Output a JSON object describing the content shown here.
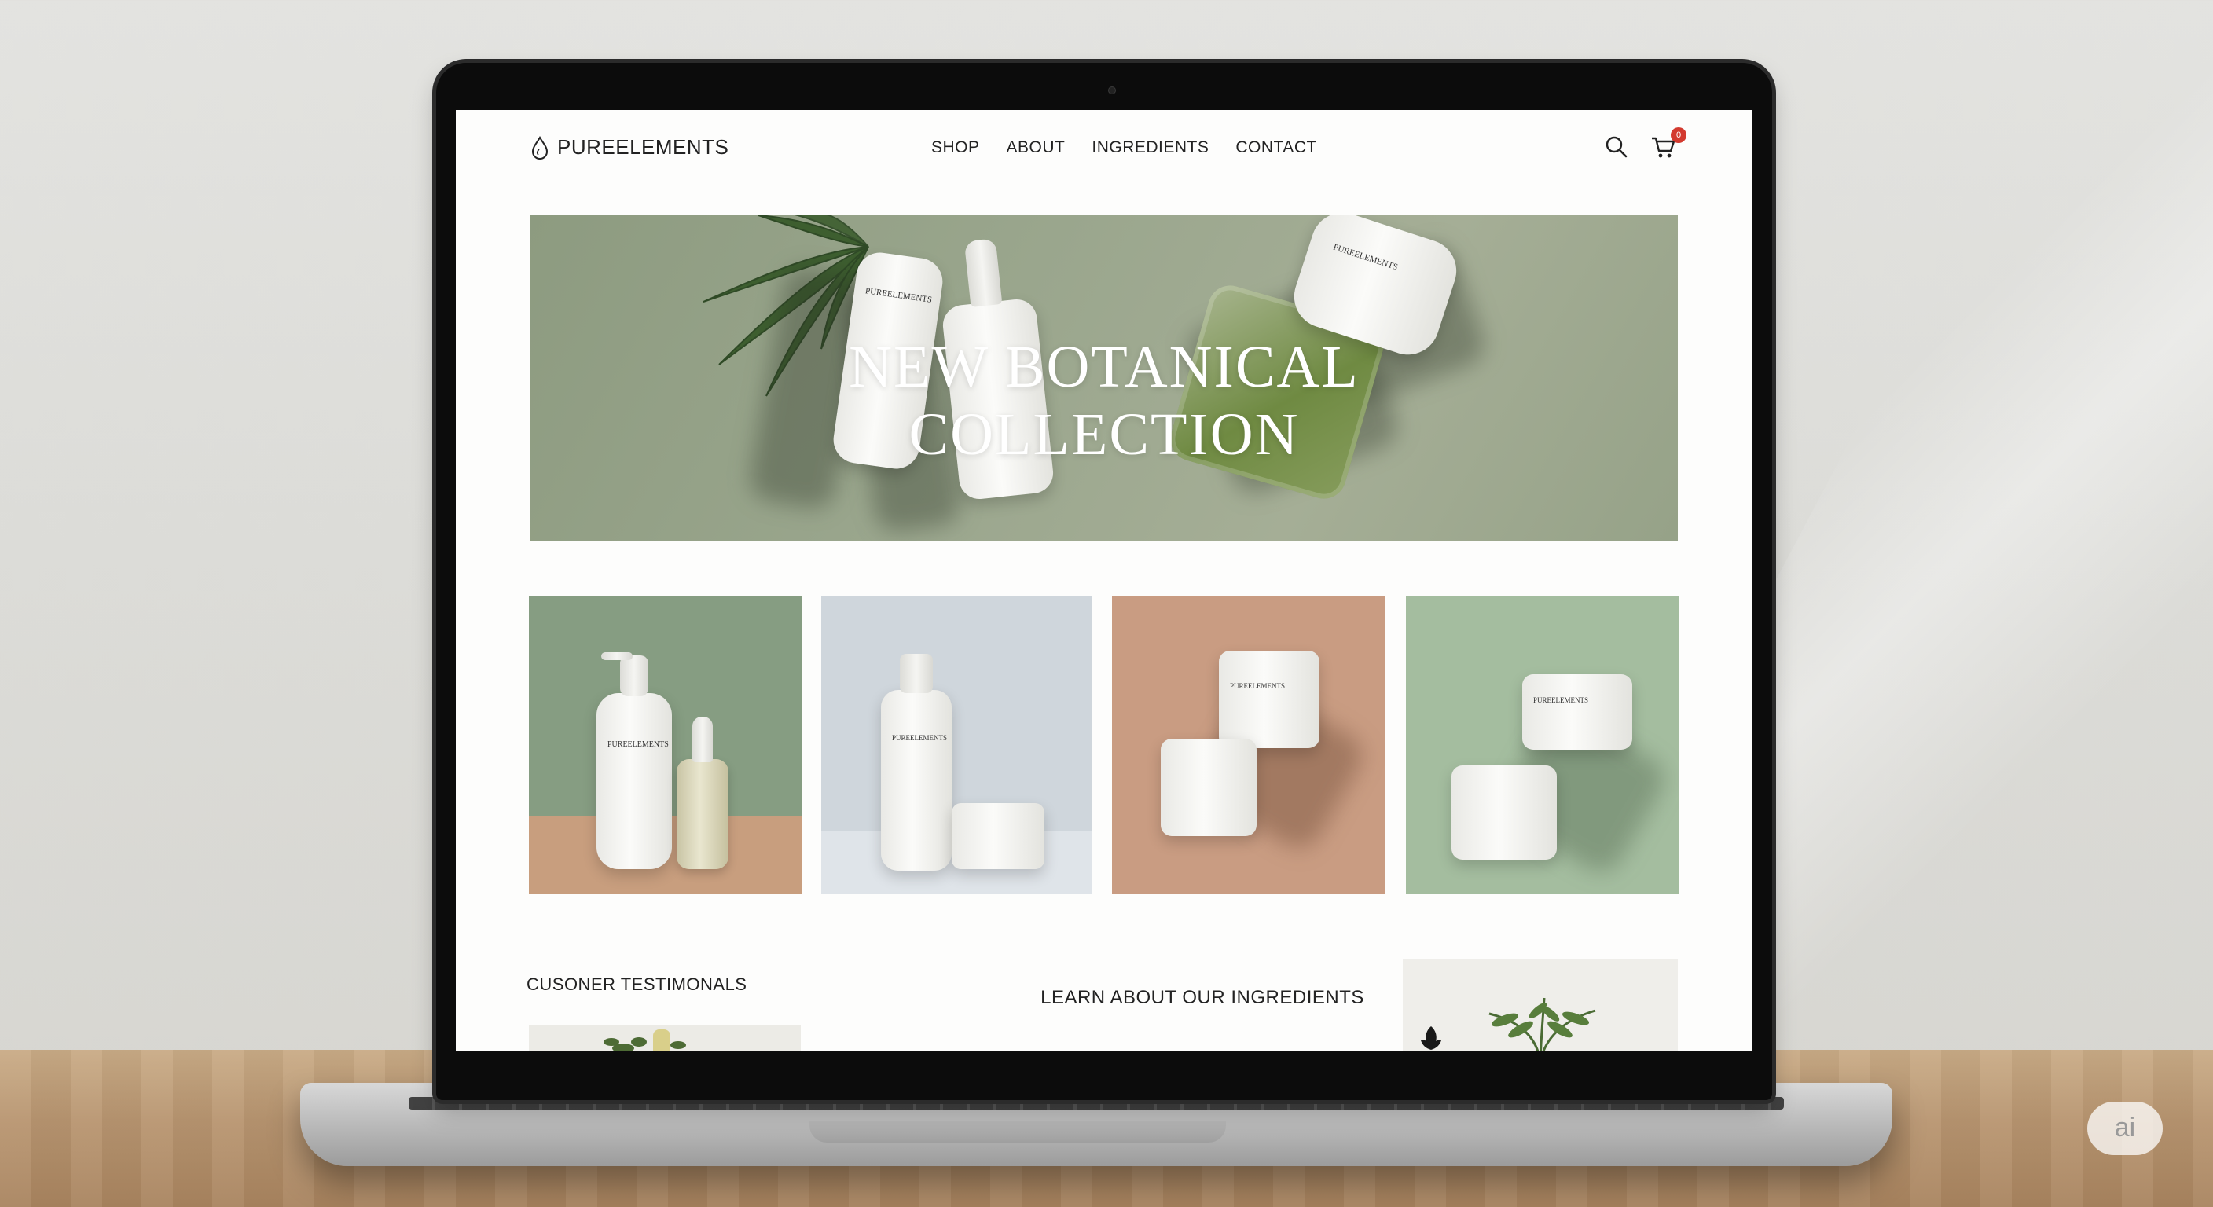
{
  "site": {
    "brand": "PUREELEMENTS",
    "nav": [
      "SHOP",
      "ABOUT",
      "INGREDIENTS",
      "CONTACT"
    ],
    "cart_count": "0"
  },
  "hero": {
    "title_line1": "NEW BOTANICAL",
    "title_line2": "COLLECTION",
    "product_labels": [
      "PUREELEMENTS",
      "PUREELEMENTS"
    ]
  },
  "products": [
    {
      "bg": "#869d82",
      "floor": "#c89e7e",
      "label": "PUREELEMENTS"
    },
    {
      "bg": "#cfd6dc",
      "floor": "#dfe4e9",
      "label": "PUREELEMENTS"
    },
    {
      "bg": "#c99c82",
      "floor": "#c99c82",
      "label": "PUREELEMENTS"
    },
    {
      "bg": "#a4bd9f",
      "floor": "#a4bd9f",
      "label": "PUREELEMENTS"
    }
  ],
  "sections": {
    "testimonials": "CUSONER TESTIMONALS",
    "ingredients": "LEARN ABOUT OUR INGREDIENTS"
  },
  "icons": {
    "brand": "water-drop-icon",
    "search": "search-icon",
    "cart": "cart-icon",
    "leaf": "leaf-icon"
  },
  "colors": {
    "accent_badge": "#d33a2f",
    "text": "#222222"
  },
  "watermark": "ai"
}
